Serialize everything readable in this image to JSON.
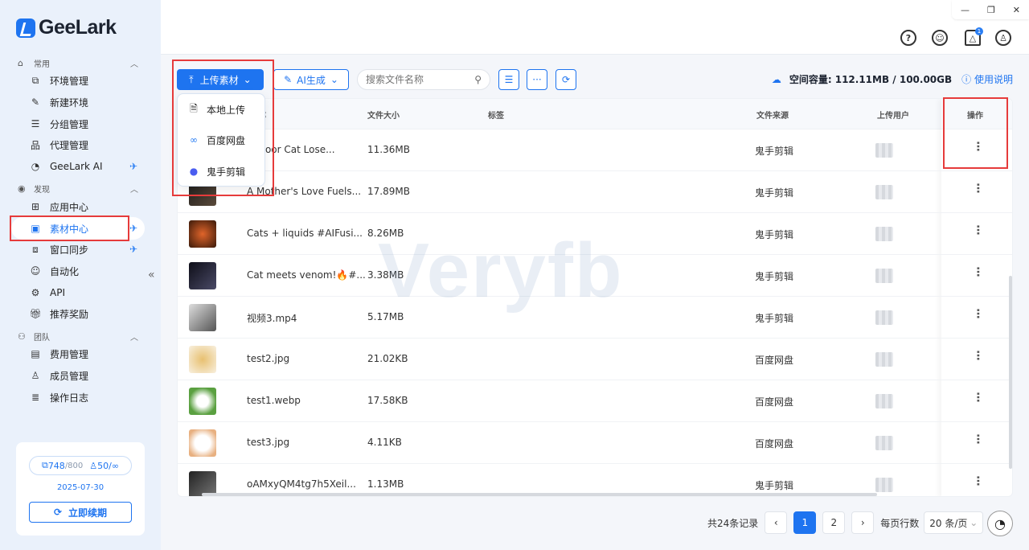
{
  "brand": {
    "name": "GeeLark"
  },
  "sidebar": {
    "sections": [
      {
        "title": "常用",
        "items": [
          {
            "label": "环境管理",
            "icon": "environment-icon"
          },
          {
            "label": "新建环境",
            "icon": "edit-icon"
          },
          {
            "label": "分组管理",
            "icon": "list-icon"
          },
          {
            "label": "代理管理",
            "icon": "proxy-icon"
          },
          {
            "label": "GeeLark AI",
            "icon": "ai-eye-icon"
          }
        ]
      },
      {
        "title": "发现",
        "items": [
          {
            "label": "应用中心",
            "icon": "apps-grid-icon"
          },
          {
            "label": "素材中心",
            "icon": "material-icon"
          },
          {
            "label": "窗口同步",
            "icon": "window-sync-icon"
          },
          {
            "label": "自动化",
            "icon": "robot-icon"
          },
          {
            "label": "API",
            "icon": "api-icon"
          },
          {
            "label": "推荐奖励",
            "icon": "gift-icon"
          }
        ]
      },
      {
        "title": "团队",
        "items": [
          {
            "label": "费用管理",
            "icon": "wallet-icon"
          },
          {
            "label": "成员管理",
            "icon": "person-icon"
          },
          {
            "label": "操作日志",
            "icon": "log-icon"
          }
        ]
      }
    ],
    "account": {
      "profiles_used": "748",
      "profiles_total": "/800",
      "members": "50/∞",
      "expiry": "2025-07-30",
      "renew_label": "立即续期"
    }
  },
  "toolbar": {
    "upload_label": "上传素材",
    "ai_label": "AI生成",
    "search_placeholder": "搜索文件名称",
    "capacity_label": "空间容量:",
    "capacity_value": "112.11MB / 100.00GB",
    "help_label": "使用说明"
  },
  "upload_menu": [
    {
      "label": "本地上传",
      "icon": "local-upload-icon"
    },
    {
      "label": "百度网盘",
      "icon": "baidu-netdisk-icon"
    },
    {
      "label": "鬼手剪辑",
      "icon": "guishou-edit-icon"
    }
  ],
  "table": {
    "columns": {
      "name": "名称",
      "size": "文件大小",
      "tags": "标签",
      "source": "文件来源",
      "uploader": "上传用户",
      "actions": "操作"
    },
    "rows": [
      {
        "name": "2) Poor Cat Lose...",
        "size": "11.36MB",
        "source": "鬼手剪辑"
      },
      {
        "name": "A Mother's Love Fuels...",
        "size": "17.89MB",
        "source": "鬼手剪辑"
      },
      {
        "name": "Cats + liquids #AIFusi...",
        "size": "8.26MB",
        "source": "鬼手剪辑"
      },
      {
        "name": "Cat meets venom!🔥#...",
        "size": "3.38MB",
        "source": "鬼手剪辑"
      },
      {
        "name": "视频3.mp4",
        "size": "5.17MB",
        "source": "鬼手剪辑"
      },
      {
        "name": "test2.jpg",
        "size": "21.02KB",
        "source": "百度网盘"
      },
      {
        "name": "test1.webp",
        "size": "17.58KB",
        "source": "百度网盘"
      },
      {
        "name": "test3.jpg",
        "size": "4.11KB",
        "source": "百度网盘"
      },
      {
        "name": "oAMxyQM4tg7h5Xeil...",
        "size": "1.13MB",
        "source": "鬼手剪辑"
      }
    ]
  },
  "pagination": {
    "total_label": "共24条记录",
    "pages": [
      "1",
      "2"
    ],
    "current": "1",
    "rows_label": "每页行数",
    "page_size": "20 条/页"
  },
  "notifications": {
    "count": "1"
  },
  "watermark": "Veryfb"
}
